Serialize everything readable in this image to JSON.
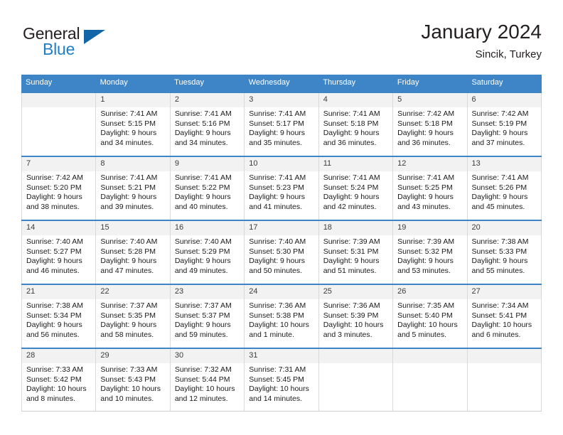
{
  "brand": {
    "name_part1": "General",
    "name_part2": "Blue",
    "triangle_color": "#1266a8",
    "blue_color": "#1f7fc6"
  },
  "header": {
    "month_title": "January 2024",
    "location": "Sincik, Turkey"
  },
  "theme": {
    "header_bg": "#3d85c6",
    "daynum_bg": "#f2f2f2",
    "grid_border": "#d9d9d9"
  },
  "weekdays": [
    "Sunday",
    "Monday",
    "Tuesday",
    "Wednesday",
    "Thursday",
    "Friday",
    "Saturday"
  ],
  "weeks": [
    [
      {
        "day": "",
        "sunrise": "",
        "sunset": "",
        "daylight_line1": "",
        "daylight_line2": ""
      },
      {
        "day": "1",
        "sunrise": "Sunrise: 7:41 AM",
        "sunset": "Sunset: 5:15 PM",
        "daylight_line1": "Daylight: 9 hours",
        "daylight_line2": "and 34 minutes."
      },
      {
        "day": "2",
        "sunrise": "Sunrise: 7:41 AM",
        "sunset": "Sunset: 5:16 PM",
        "daylight_line1": "Daylight: 9 hours",
        "daylight_line2": "and 34 minutes."
      },
      {
        "day": "3",
        "sunrise": "Sunrise: 7:41 AM",
        "sunset": "Sunset: 5:17 PM",
        "daylight_line1": "Daylight: 9 hours",
        "daylight_line2": "and 35 minutes."
      },
      {
        "day": "4",
        "sunrise": "Sunrise: 7:41 AM",
        "sunset": "Sunset: 5:18 PM",
        "daylight_line1": "Daylight: 9 hours",
        "daylight_line2": "and 36 minutes."
      },
      {
        "day": "5",
        "sunrise": "Sunrise: 7:42 AM",
        "sunset": "Sunset: 5:18 PM",
        "daylight_line1": "Daylight: 9 hours",
        "daylight_line2": "and 36 minutes."
      },
      {
        "day": "6",
        "sunrise": "Sunrise: 7:42 AM",
        "sunset": "Sunset: 5:19 PM",
        "daylight_line1": "Daylight: 9 hours",
        "daylight_line2": "and 37 minutes."
      }
    ],
    [
      {
        "day": "7",
        "sunrise": "Sunrise: 7:42 AM",
        "sunset": "Sunset: 5:20 PM",
        "daylight_line1": "Daylight: 9 hours",
        "daylight_line2": "and 38 minutes."
      },
      {
        "day": "8",
        "sunrise": "Sunrise: 7:41 AM",
        "sunset": "Sunset: 5:21 PM",
        "daylight_line1": "Daylight: 9 hours",
        "daylight_line2": "and 39 minutes."
      },
      {
        "day": "9",
        "sunrise": "Sunrise: 7:41 AM",
        "sunset": "Sunset: 5:22 PM",
        "daylight_line1": "Daylight: 9 hours",
        "daylight_line2": "and 40 minutes."
      },
      {
        "day": "10",
        "sunrise": "Sunrise: 7:41 AM",
        "sunset": "Sunset: 5:23 PM",
        "daylight_line1": "Daylight: 9 hours",
        "daylight_line2": "and 41 minutes."
      },
      {
        "day": "11",
        "sunrise": "Sunrise: 7:41 AM",
        "sunset": "Sunset: 5:24 PM",
        "daylight_line1": "Daylight: 9 hours",
        "daylight_line2": "and 42 minutes."
      },
      {
        "day": "12",
        "sunrise": "Sunrise: 7:41 AM",
        "sunset": "Sunset: 5:25 PM",
        "daylight_line1": "Daylight: 9 hours",
        "daylight_line2": "and 43 minutes."
      },
      {
        "day": "13",
        "sunrise": "Sunrise: 7:41 AM",
        "sunset": "Sunset: 5:26 PM",
        "daylight_line1": "Daylight: 9 hours",
        "daylight_line2": "and 45 minutes."
      }
    ],
    [
      {
        "day": "14",
        "sunrise": "Sunrise: 7:40 AM",
        "sunset": "Sunset: 5:27 PM",
        "daylight_line1": "Daylight: 9 hours",
        "daylight_line2": "and 46 minutes."
      },
      {
        "day": "15",
        "sunrise": "Sunrise: 7:40 AM",
        "sunset": "Sunset: 5:28 PM",
        "daylight_line1": "Daylight: 9 hours",
        "daylight_line2": "and 47 minutes."
      },
      {
        "day": "16",
        "sunrise": "Sunrise: 7:40 AM",
        "sunset": "Sunset: 5:29 PM",
        "daylight_line1": "Daylight: 9 hours",
        "daylight_line2": "and 49 minutes."
      },
      {
        "day": "17",
        "sunrise": "Sunrise: 7:40 AM",
        "sunset": "Sunset: 5:30 PM",
        "daylight_line1": "Daylight: 9 hours",
        "daylight_line2": "and 50 minutes."
      },
      {
        "day": "18",
        "sunrise": "Sunrise: 7:39 AM",
        "sunset": "Sunset: 5:31 PM",
        "daylight_line1": "Daylight: 9 hours",
        "daylight_line2": "and 51 minutes."
      },
      {
        "day": "19",
        "sunrise": "Sunrise: 7:39 AM",
        "sunset": "Sunset: 5:32 PM",
        "daylight_line1": "Daylight: 9 hours",
        "daylight_line2": "and 53 minutes."
      },
      {
        "day": "20",
        "sunrise": "Sunrise: 7:38 AM",
        "sunset": "Sunset: 5:33 PM",
        "daylight_line1": "Daylight: 9 hours",
        "daylight_line2": "and 55 minutes."
      }
    ],
    [
      {
        "day": "21",
        "sunrise": "Sunrise: 7:38 AM",
        "sunset": "Sunset: 5:34 PM",
        "daylight_line1": "Daylight: 9 hours",
        "daylight_line2": "and 56 minutes."
      },
      {
        "day": "22",
        "sunrise": "Sunrise: 7:37 AM",
        "sunset": "Sunset: 5:35 PM",
        "daylight_line1": "Daylight: 9 hours",
        "daylight_line2": "and 58 minutes."
      },
      {
        "day": "23",
        "sunrise": "Sunrise: 7:37 AM",
        "sunset": "Sunset: 5:37 PM",
        "daylight_line1": "Daylight: 9 hours",
        "daylight_line2": "and 59 minutes."
      },
      {
        "day": "24",
        "sunrise": "Sunrise: 7:36 AM",
        "sunset": "Sunset: 5:38 PM",
        "daylight_line1": "Daylight: 10 hours",
        "daylight_line2": "and 1 minute."
      },
      {
        "day": "25",
        "sunrise": "Sunrise: 7:36 AM",
        "sunset": "Sunset: 5:39 PM",
        "daylight_line1": "Daylight: 10 hours",
        "daylight_line2": "and 3 minutes."
      },
      {
        "day": "26",
        "sunrise": "Sunrise: 7:35 AM",
        "sunset": "Sunset: 5:40 PM",
        "daylight_line1": "Daylight: 10 hours",
        "daylight_line2": "and 5 minutes."
      },
      {
        "day": "27",
        "sunrise": "Sunrise: 7:34 AM",
        "sunset": "Sunset: 5:41 PM",
        "daylight_line1": "Daylight: 10 hours",
        "daylight_line2": "and 6 minutes."
      }
    ],
    [
      {
        "day": "28",
        "sunrise": "Sunrise: 7:33 AM",
        "sunset": "Sunset: 5:42 PM",
        "daylight_line1": "Daylight: 10 hours",
        "daylight_line2": "and 8 minutes."
      },
      {
        "day": "29",
        "sunrise": "Sunrise: 7:33 AM",
        "sunset": "Sunset: 5:43 PM",
        "daylight_line1": "Daylight: 10 hours",
        "daylight_line2": "and 10 minutes."
      },
      {
        "day": "30",
        "sunrise": "Sunrise: 7:32 AM",
        "sunset": "Sunset: 5:44 PM",
        "daylight_line1": "Daylight: 10 hours",
        "daylight_line2": "and 12 minutes."
      },
      {
        "day": "31",
        "sunrise": "Sunrise: 7:31 AM",
        "sunset": "Sunset: 5:45 PM",
        "daylight_line1": "Daylight: 10 hours",
        "daylight_line2": "and 14 minutes."
      },
      {
        "day": "",
        "sunrise": "",
        "sunset": "",
        "daylight_line1": "",
        "daylight_line2": ""
      },
      {
        "day": "",
        "sunrise": "",
        "sunset": "",
        "daylight_line1": "",
        "daylight_line2": ""
      },
      {
        "day": "",
        "sunrise": "",
        "sunset": "",
        "daylight_line1": "",
        "daylight_line2": ""
      }
    ]
  ]
}
